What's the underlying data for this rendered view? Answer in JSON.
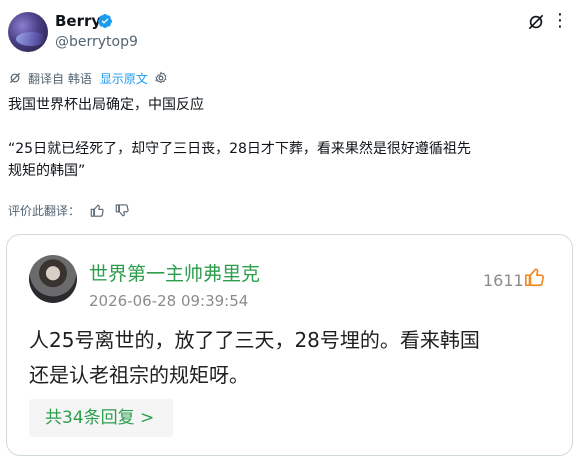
{
  "author": {
    "name": "Berry",
    "handle": "@berrytop9"
  },
  "translation_bar": {
    "label": "翻译自 韩语",
    "show_original": "显示原文"
  },
  "tweet": {
    "line1": "我国世界杯出局确定，中国反应",
    "line2": "“25日就已经死了，却守了三日丧，28日才下葬，看来果然是很好遵循祖先",
    "line3": "规矩的韩国”"
  },
  "rate": {
    "label": "评价此翻译："
  },
  "embedded": {
    "name": "世界第一主帅弗里克",
    "date": "2026-06-28 09:39:54",
    "likes": "1611",
    "body_line1": "人25号离世的，放了了三天，28号埋的。看来韩国",
    "body_line2": "还是认老祖宗的规矩呀。",
    "replies": "共34条回复 >"
  },
  "colors": {
    "link": "#1d9bf0",
    "verified": "#1d9bf0",
    "weibo_green": "#2e9e4e",
    "like_orange": "#f08a24"
  },
  "icons": [
    "verified-badge-icon",
    "grok-icon",
    "more-icon",
    "translate-icon",
    "settings-icon",
    "thumbs-up-icon",
    "thumbs-down-icon",
    "like-icon"
  ]
}
